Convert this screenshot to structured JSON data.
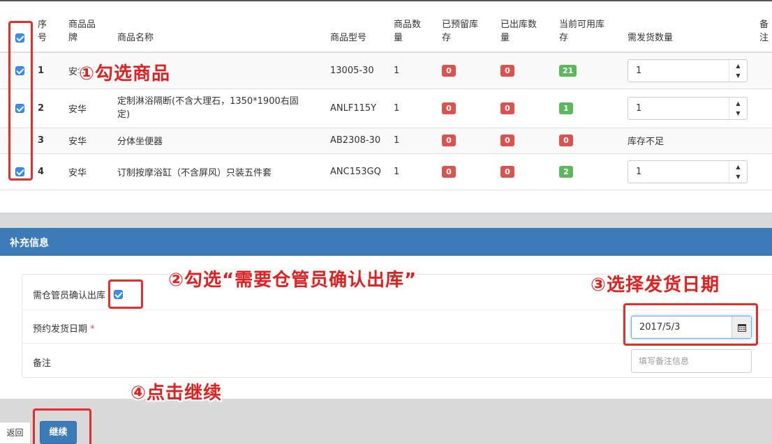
{
  "table": {
    "headers": {
      "seq": [
        "序",
        "号"
      ],
      "brand": [
        "商品品",
        "牌"
      ],
      "name": "商品名称",
      "model": "商品型号",
      "qty": [
        "商品数",
        "量"
      ],
      "reserved": [
        "已预留库",
        "存"
      ],
      "shipped": [
        "已出库数",
        "量"
      ],
      "available": [
        "当前可用库",
        "存"
      ],
      "ship_qty": "需发货数量",
      "note": [
        "备",
        "注"
      ]
    },
    "rows": [
      {
        "checked": true,
        "seq": "1",
        "brand": "安华",
        "name": "",
        "model": "13005-30",
        "qty": "1",
        "reserved": "0",
        "shipped": "0",
        "available": "21",
        "available_color": "#5cb85c",
        "ship_qty": "1"
      },
      {
        "checked": true,
        "seq": "2",
        "brand": "安华",
        "name": [
          "定制淋浴隔断(不含大理石，1350*1900右固",
          "定)"
        ],
        "model": "ANLF115Y",
        "qty": "1",
        "reserved": "0",
        "shipped": "0",
        "available": "1",
        "available_color": "#5cb85c",
        "ship_qty": "1"
      },
      {
        "checked": false,
        "seq": "3",
        "brand": "安华",
        "name": "分体坐便器",
        "model": "AB2308-30",
        "qty": "1",
        "reserved": "0",
        "shipped": "0",
        "available": "0",
        "available_color": "#d9534f",
        "stock_status": "库存不足"
      },
      {
        "checked": true,
        "seq": "4",
        "brand": "安华",
        "name": "订制按摩浴缸（不含屏风）只装五件套",
        "model": "ANC153GQ",
        "qty": "1",
        "reserved": "0",
        "shipped": "0",
        "available": "2",
        "available_color": "#5cb85c",
        "ship_qty": "1"
      }
    ]
  },
  "annotations": {
    "step1": "①勾选商品",
    "step2": "②勾选“需要仓管员确认出库”",
    "step3": "③选择发货日期",
    "step4": "④点击继续"
  },
  "supplement": {
    "title": "补充信息",
    "confirm_label": "需仓管员确认出库",
    "confirm_checked": true,
    "date_label": "预约发货日期",
    "required_mark": "*",
    "date_value": "2017/5/3",
    "note_label": "备注",
    "note_placeholder": "填写备注信息"
  },
  "buttons": {
    "back": "返回",
    "continue": "继续"
  },
  "colors": {
    "primary": "#3c7ab8",
    "danger": "#d9534f",
    "success": "#5cb85c",
    "annotation": "#e02020"
  },
  "icons": {
    "calendar": "calendar-icon",
    "stepper": "spinner-arrows-icon"
  }
}
